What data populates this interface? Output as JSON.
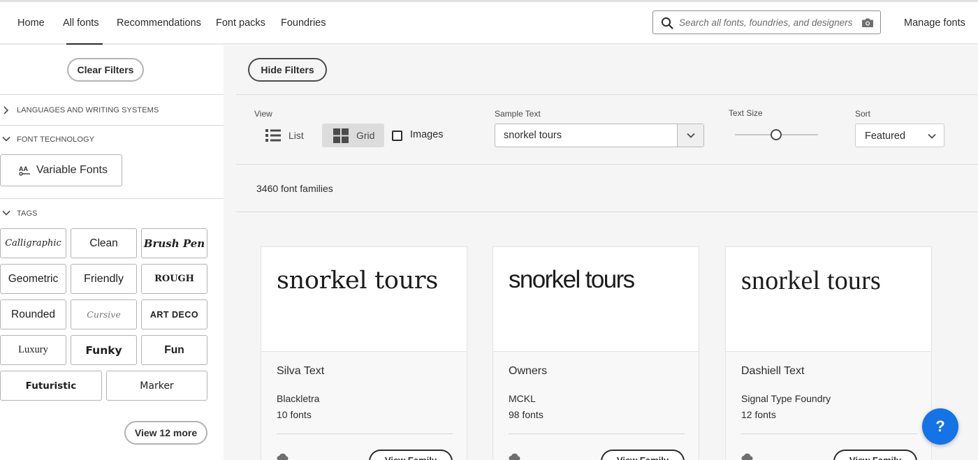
{
  "nav": {
    "items": [
      "Home",
      "All fonts",
      "Recommendations",
      "Font packs",
      "Foundries"
    ],
    "active": "All fonts",
    "search_placeholder": "Search all fonts, foundries, and designers",
    "manage": "Manage fonts"
  },
  "sidebar": {
    "clear_filters": "Clear Filters",
    "sections": {
      "languages": "LANGUAGES AND WRITING SYSTEMS",
      "technology": "FONT TECHNOLOGY",
      "tags": "TAGS"
    },
    "variable_fonts": "Variable Fonts",
    "tags": [
      "Calligraphic",
      "Clean",
      "Brush Pen",
      "Geometric",
      "Friendly",
      "ROUGH",
      "Rounded",
      "Cursive",
      "ART DECO",
      "Luxury",
      "Funky",
      "Fun",
      "Futuristic",
      "Marker"
    ],
    "view_more": "View 12 more"
  },
  "toolbar": {
    "hide_filters": "Hide Filters",
    "view_label": "View",
    "list": "List",
    "grid": "Grid",
    "images": "Images",
    "sample_label": "Sample Text",
    "sample_value": "snorkel tours",
    "text_size_label": "Text Size",
    "text_size_level": 0.5,
    "sort_label": "Sort",
    "sort_value": "Featured"
  },
  "results": {
    "count": "3460 font families"
  },
  "cards": [
    {
      "sample": "snorkel tours",
      "name": "Silva Text",
      "foundry": "Blackletra",
      "fonts": "10 fonts"
    },
    {
      "sample": "snorkel tours",
      "name": "Owners",
      "foundry": "MCKL",
      "fonts": "98 fonts"
    },
    {
      "sample": "snorkel tours",
      "name": "Dashiell Text",
      "foundry": "Signal Type Foundry",
      "fonts": "12 fonts"
    }
  ],
  "card_action": "View Family",
  "help": "?"
}
